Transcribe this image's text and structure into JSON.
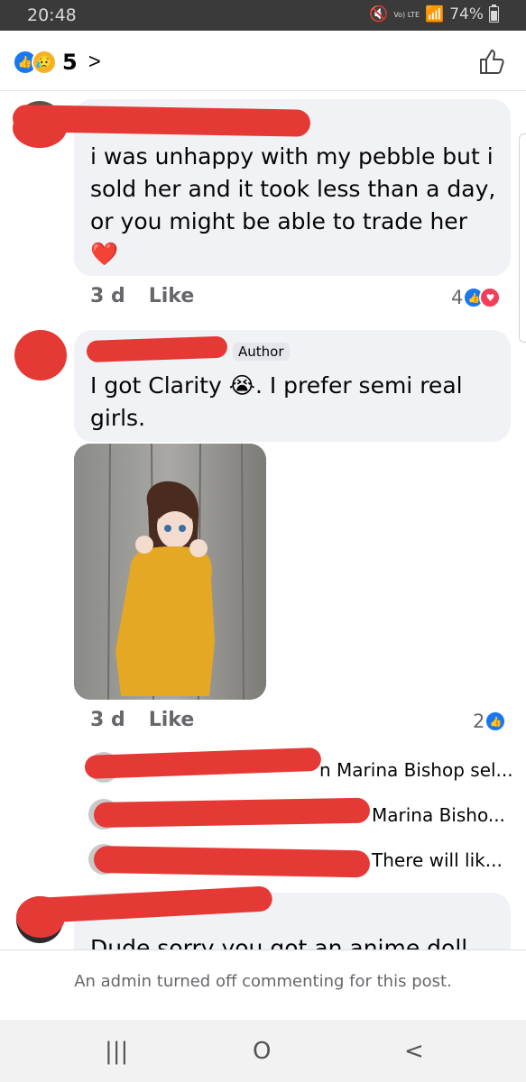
{
  "status_bar": {
    "time": "20:48",
    "network": "Vo) LTE",
    "battery": "74%"
  },
  "header": {
    "reaction_count": "5",
    "chevron": ">",
    "reactions": [
      "like-icon",
      "sad-icon"
    ]
  },
  "comments": [
    {
      "text_lines": [
        "i was unhappy with my pebble but i",
        "sold her and it took less than a day,",
        "or you might be able to trade her"
      ],
      "emoji": "❤️",
      "time": "3 d",
      "like_label": "Like",
      "reaction_count": "4"
    },
    {
      "author_badge": "Author",
      "text_line1_a": "I got Clarity ",
      "text_emoji": "😭",
      "text_line1_b": ". I prefer semi real",
      "text_line2": "girls.",
      "time": "3 d",
      "like_label": "Like",
      "reaction_count": "2"
    },
    {
      "text": "Dude sorry you got an anime doll"
    }
  ],
  "replies": [
    {
      "preview": "n Marina Bishop sel..."
    },
    {
      "preview": "Marina Bisho..."
    },
    {
      "preview": "There will lik..."
    }
  ],
  "footer": {
    "message": "An admin turned off commenting for this post."
  },
  "nav": {
    "recent": "|||",
    "home": "O",
    "back": "<"
  },
  "colors": {
    "like_blue": "#1877f2",
    "bubble": "#f0f2f5",
    "redaction": "#e53935",
    "love_red": "#f33e58"
  }
}
